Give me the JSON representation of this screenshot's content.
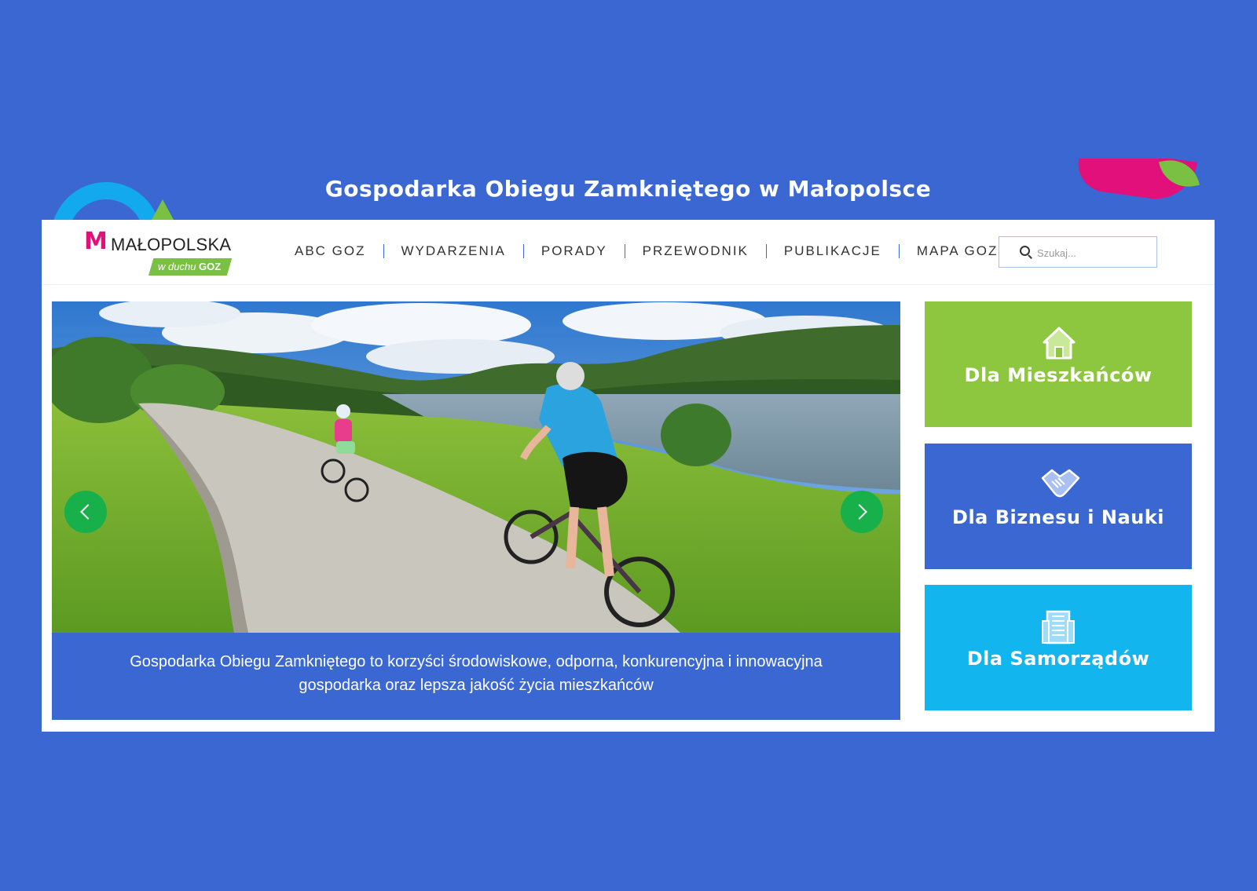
{
  "site": {
    "banner_title": "Gospodarka Obiegu Zamkniętego w Małopolsce",
    "logo_word": "MAŁOPOLSKA",
    "logo_tag_prefix": "w duchu ",
    "logo_tag_bold": "GOZ"
  },
  "nav": {
    "items": [
      {
        "label": "ABC GOZ"
      },
      {
        "label": "WYDARZENIA"
      },
      {
        "label": "PORADY"
      },
      {
        "label": "PRZEWODNIK"
      },
      {
        "label": "PUBLIKACJE"
      },
      {
        "label": "MAPA GOZ"
      }
    ]
  },
  "search": {
    "placeholder": "Szukaj...",
    "value": ""
  },
  "hero": {
    "caption": "Gospodarka Obiegu Zamkniętego to korzyści środowiskowe, odporna, konkurencyjna i innowacyjna gospodarka oraz lepsza jakość życia mieszkańców"
  },
  "tiles": [
    {
      "label": "Dla Mieszkańców",
      "icon": "house-icon",
      "color": "#8dc63f"
    },
    {
      "label": "Dla Biznesu i Nauki",
      "icon": "handshake-icon",
      "color": "#3a67d1"
    },
    {
      "label": "Dla Samorządów",
      "icon": "building-icon",
      "color": "#12b5ee"
    }
  ],
  "colors": {
    "background": "#3a67d1",
    "accent_green": "#8dc63f",
    "accent_cyan": "#12b5ee",
    "slider_arrow": "#18b04b",
    "brand_pink": "#e2107b"
  }
}
